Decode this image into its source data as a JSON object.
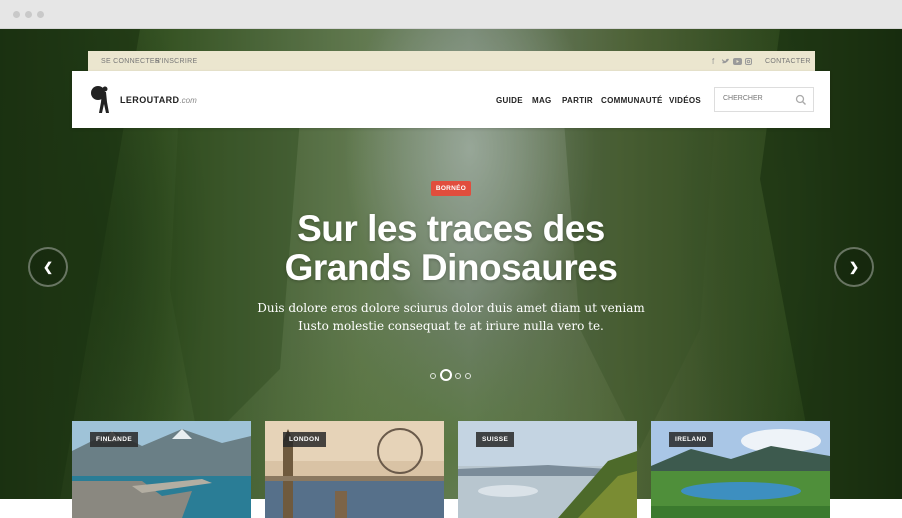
{
  "topbar": {
    "login": "SE CONNECTER",
    "register": "S'INSCRIRE",
    "contact": "CONTACTER",
    "social_icons": [
      "facebook-icon",
      "twitter-icon",
      "youtube-icon",
      "instagram-icon"
    ]
  },
  "brand": {
    "name": "LEROUTARD",
    "suffix": ".com"
  },
  "menu": [
    "GUIDE",
    "MAG",
    "PARTIR",
    "COMMUNAUTÉ",
    "VIDÉOS"
  ],
  "search": {
    "placeholder": "CHERCHER"
  },
  "hero": {
    "tag": "BORNÉO",
    "title_line1": "Sur les traces des",
    "title_line2": "Grands Dinosaures",
    "subtitle_line1": "Duis dolore eros dolore sciurus dolor duis amet diam ut veniam",
    "subtitle_line2": "Iusto molestie consequat te at iriure nulla vero te.",
    "slide_count": 4,
    "active_slide": 2
  },
  "cards": [
    {
      "label": "FINLANDE"
    },
    {
      "label": "LONDON"
    },
    {
      "label": "SUISSE"
    },
    {
      "label": "IRELAND"
    }
  ],
  "colors": {
    "tag_red": "#e14d3d",
    "topbar_bg": "#ebe6cf"
  }
}
